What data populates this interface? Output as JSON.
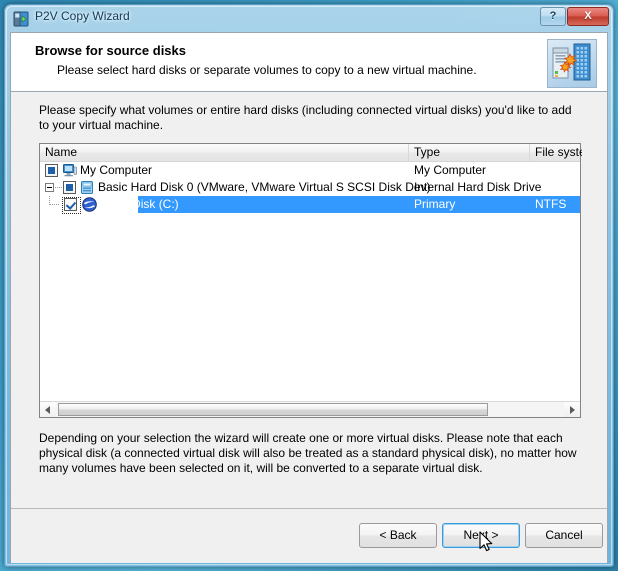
{
  "window": {
    "title": "P2V Copy Wizard",
    "icon": "p2v-wizard-icon",
    "caption_buttons": {
      "help_label": "?",
      "close_label": "X"
    }
  },
  "banner": {
    "title": "Browse for source disks",
    "subtitle": "Please select hard disks or separate volumes to copy to a new virtual machine.",
    "icon": "server-to-server-copy-icon"
  },
  "instruction": "Please specify what volumes or entire hard disks (including connected virtual disks) you'd like to add to your virtual machine.",
  "listview": {
    "columns": [
      {
        "label": "Name"
      },
      {
        "label": "Type"
      },
      {
        "label": "File system"
      }
    ],
    "rows": [
      {
        "name": "My Computer",
        "type": "My Computer",
        "filesystem": "",
        "icon": "my-computer-icon",
        "checkbox_state": "partial",
        "indent": 0,
        "selected": false,
        "expander": "none",
        "focused": false
      },
      {
        "name": "Basic Hard Disk 0 (VMware, VMware Virtual S SCSI Disk Dev)",
        "type": "Internal Hard Disk Drive",
        "filesystem": "",
        "icon": "hard-disk-icon",
        "checkbox_state": "partial",
        "indent": 1,
        "selected": false,
        "expander": "collapse",
        "focused": false
      },
      {
        "name": "Local Disk (C:)",
        "type": "Primary",
        "filesystem": "NTFS",
        "icon": "local-disk-icon",
        "checkbox_state": "checked",
        "indent": 2,
        "selected": true,
        "expander": "none",
        "focused": true
      }
    ],
    "hscrollbar": {
      "left_arrow": "scroll-left-icon",
      "right_arrow": "scroll-right-icon"
    }
  },
  "footnote": "Depending on your selection the wizard will create one or more virtual disks. Please note that each physical disk (a connected virtual disk will also be treated as a standard physical disk), no matter how many volumes have been selected on it, will be converted to a separate virtual disk.",
  "buttons": {
    "back": "< Back",
    "next": "Next >",
    "cancel": "Cancel"
  },
  "colors": {
    "selection": "#3399ff",
    "close_button": "#bf3a2c",
    "focus_border": "#3d9ad8"
  }
}
